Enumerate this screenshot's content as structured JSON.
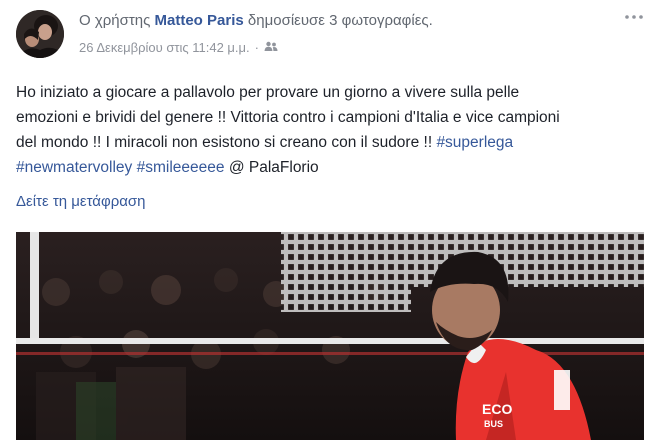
{
  "post": {
    "header": {
      "prefix": "Ο χρήστης",
      "author": "Matteo Paris",
      "action": "δημοσίευσε 3 φωτογραφίες."
    },
    "meta": {
      "date": "26 Δεκεμβρίου στις 11:42 μ.μ.",
      "separator": "·",
      "audience_icon": "friends-icon"
    },
    "menu_icon": "more-options-icon",
    "text": {
      "line1": "Ho iniziato a giocare a pallavolo per provare un giorno a vivere sulla pelle",
      "line2": "emozioni e brividi del genere !! Vittoria contro i campioni d'Italia e vice campioni",
      "line3": "del mondo !! I miracoli non esistono si creano con il sudore !! ",
      "hashtag1": "#superlega",
      "hashtag2": "#newmatervolley",
      "hashtag3": "#smileeeeee",
      "location": " @ PalaFlorio"
    },
    "translate_link": "Δείτε τη μετάφραση",
    "photo": {
      "jersey_text": "ECO",
      "jersey_text2": "BUS",
      "colors": {
        "jersey": "#e8322e",
        "background": "#171212",
        "net": "#d9d9d9"
      }
    },
    "colors": {
      "link": "#365899",
      "meta": "#90949c",
      "text": "#1d2129"
    }
  }
}
